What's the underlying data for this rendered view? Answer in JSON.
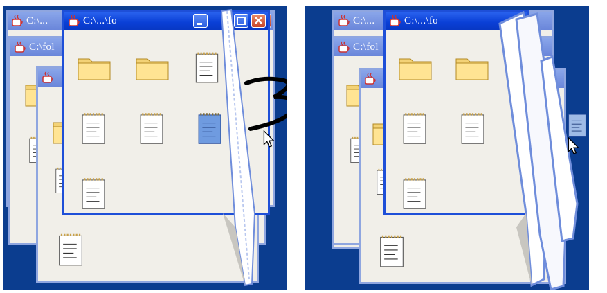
{
  "left_panel": {
    "windows": [
      {
        "title": "C:\\..."
      },
      {
        "title": "C:\\fol"
      },
      {
        "title": "C:\\...\\fo"
      }
    ]
  },
  "right_panel": {
    "windows": [
      {
        "title": "C:\\..."
      },
      {
        "title": "C:\\fol"
      },
      {
        "title": "C:\\...\\fo"
      }
    ]
  },
  "colors": {
    "desktop": "#0b3d8f",
    "active_title": "#0a3fd6",
    "inactive_title": "#7a96e2",
    "window_bg": "#f1efe9",
    "selected_file": "#6f9be0"
  },
  "icons": [
    "java-cup-icon",
    "folder-icon",
    "notepad-file-icon",
    "mouse-cursor-icon",
    "minimize-icon",
    "maximize-icon",
    "close-icon"
  ]
}
